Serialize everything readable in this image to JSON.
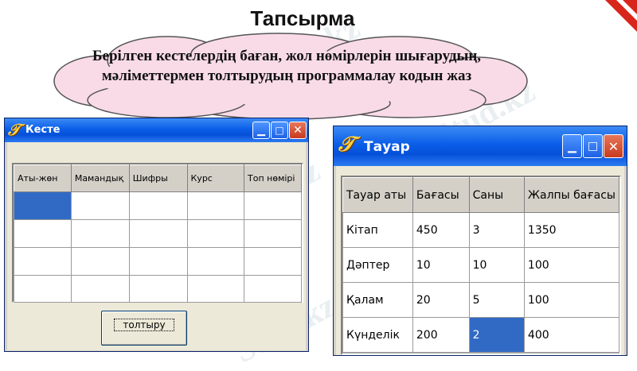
{
  "slide": {
    "title": "Тапсырма",
    "task_text": "Берілген кестелердің баған, жол нөмірлерін шығарудың, мәліметтермен толтырудың программалау кодын жаз"
  },
  "watermark": "Stud.kz",
  "colors": {
    "titlebar": "#0a5ee8",
    "selection": "#316ac5",
    "ribbon": "#d8261c",
    "cloud_fill": "#f9dbe7"
  },
  "window_keste": {
    "title": "Кесте",
    "icon": "delphi-app-icon",
    "columns": [
      "Аты-жөн",
      "Мамандық",
      "Шифры",
      "Курс",
      "Топ нөмірі"
    ],
    "rows": [
      [
        "",
        "",
        "",
        "",
        ""
      ],
      [
        "",
        "",
        "",
        "",
        ""
      ],
      [
        "",
        "",
        "",
        "",
        ""
      ],
      [
        "",
        "",
        "",
        "",
        ""
      ]
    ],
    "selected_cell": [
      0,
      0
    ],
    "button_label": "толтыру"
  },
  "window_tauar": {
    "title": "Тауар",
    "icon": "delphi-app-icon",
    "columns": [
      "Тауар аты",
      "Бағасы",
      "Саны",
      "Жалпы бағасы"
    ],
    "rows": [
      [
        "Кітап",
        "450",
        "3",
        "1350"
      ],
      [
        "Дәптер",
        "10",
        "10",
        "100"
      ],
      [
        "Қалам",
        "20",
        "5",
        "100"
      ],
      [
        "Күнделік",
        "200",
        "2",
        "400"
      ]
    ],
    "selected_cell": [
      3,
      2
    ]
  }
}
